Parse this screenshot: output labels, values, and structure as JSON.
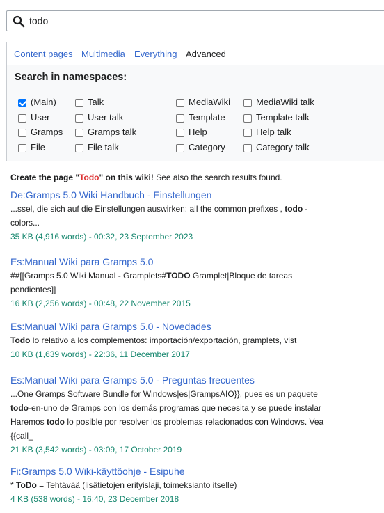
{
  "search": {
    "value": "todo"
  },
  "tabs": [
    {
      "label": "Content pages"
    },
    {
      "label": "Multimedia"
    },
    {
      "label": "Everything"
    },
    {
      "label": "Advanced"
    }
  ],
  "namespaces": {
    "title": "Search in namespaces:",
    "items": [
      {
        "label": "(Main)",
        "checked": true
      },
      {
        "label": "User",
        "checked": false
      },
      {
        "label": "Gramps",
        "checked": false
      },
      {
        "label": "File",
        "checked": false
      },
      {
        "label": "Talk",
        "checked": false
      },
      {
        "label": "User talk",
        "checked": false
      },
      {
        "label": "Gramps talk",
        "checked": false
      },
      {
        "label": "File talk",
        "checked": false
      },
      {
        "label": "MediaWiki",
        "checked": false
      },
      {
        "label": "Template",
        "checked": false
      },
      {
        "label": "Help",
        "checked": false
      },
      {
        "label": "Category",
        "checked": false
      },
      {
        "label": "MediaWiki talk",
        "checked": false
      },
      {
        "label": "Template talk",
        "checked": false
      },
      {
        "label": "Help talk",
        "checked": false
      },
      {
        "label": "Category talk",
        "checked": false
      }
    ]
  },
  "create": {
    "prefix": "Create the page \"",
    "page": "Todo",
    "suffix": "\" on this wiki!",
    "extra": " See also the search results found."
  },
  "results": [
    {
      "title": "De:Gramps 5.0 Wiki Handbuch - Einstellungen",
      "snippet_lines": [
        [
          "...ssel, die sich auf die Einstellungen auswirken: all the common prefixes , ",
          {
            "b": "todo"
          },
          " -"
        ],
        [
          "colors..."
        ]
      ],
      "meta": "35 KB (4,916 words) - 00:32, 23 September 2023"
    },
    {
      "title": "Es:Manual Wiki para Gramps 5.0",
      "snippet_lines": [
        [
          "##[[Gramps 5.0 Wiki Manual - Gramplets#",
          {
            "b": "TODO"
          },
          " Gramplet|Bloque de tareas"
        ],
        [
          "pendientes]]"
        ]
      ],
      "meta": "16 KB (2,256 words) - 00:48, 22 November 2015"
    },
    {
      "title": "Es:Manual Wiki para Gramps 5.0 - Novedades",
      "snippet_lines": [
        [
          {
            "b": "Todo"
          },
          " lo relativo a los complementos: importación/exportación, gramplets, vist"
        ]
      ],
      "meta": "10 KB (1,639 words) - 22:36, 11 December 2017"
    },
    {
      "title": "Es:Manual Wiki para Gramps 5.0 - Preguntas frecuentes",
      "snippet_lines": [
        [
          "...One Gramps Software Bundle for Windows|es|GrampsAIO}}, pues es un paquete"
        ],
        [
          {
            "b": "todo"
          },
          "-en-uno de Gramps con los demás programas que necesita y se puede instalar"
        ],
        [
          "Haremos ",
          {
            "b": "todo"
          },
          " lo posible por resolver los problemas relacionados con Windows. Vea"
        ],
        [
          "{{call_"
        ]
      ],
      "meta": "21 KB (3,542 words) - 03:09, 17 October 2019"
    },
    {
      "title": "Fi:Gramps 5.0 Wiki-käyttöohje - Esipuhe",
      "snippet_lines": [
        [
          "* ",
          {
            "b": "ToDo"
          },
          " = Tehtävää (lisätietojen erityislaji, toimeksianto itselle)"
        ]
      ],
      "meta": "4 KB (538 words) - 16:40, 23 December 2018"
    }
  ]
}
